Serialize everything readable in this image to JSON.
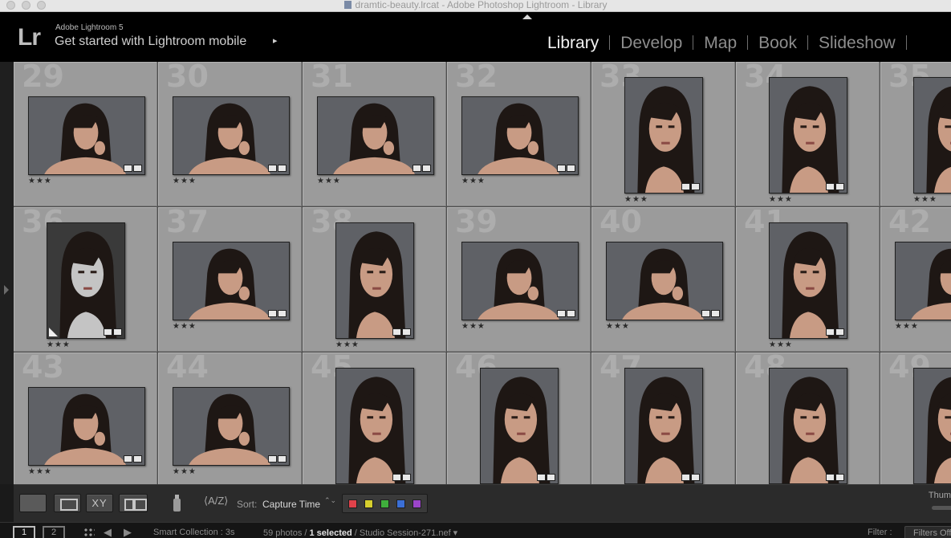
{
  "window": {
    "title": "dramtic-beauty.lrcat - Adobe Photoshop Lightroom - Library"
  },
  "identity": {
    "logo": "Lr",
    "version": "Adobe Lightroom 5",
    "mobile_prompt": "Get started with Lightroom mobile",
    "mobile_arrow": "▸"
  },
  "modules": [
    {
      "label": "Library",
      "active": true
    },
    {
      "label": "Develop",
      "active": false
    },
    {
      "label": "Map",
      "active": false
    },
    {
      "label": "Book",
      "active": false
    },
    {
      "label": "Slideshow",
      "active": false
    }
  ],
  "grid": {
    "stars": "★★★",
    "cells": [
      {
        "index": "29",
        "orientation": "landscape",
        "tone": "color"
      },
      {
        "index": "30",
        "orientation": "landscape",
        "tone": "color"
      },
      {
        "index": "31",
        "orientation": "landscape",
        "tone": "color"
      },
      {
        "index": "32",
        "orientation": "landscape",
        "tone": "color"
      },
      {
        "index": "33",
        "orientation": "portrait",
        "tone": "color"
      },
      {
        "index": "34",
        "orientation": "portrait",
        "tone": "color"
      },
      {
        "index": "35",
        "orientation": "portrait",
        "tone": "color"
      },
      {
        "index": "36",
        "orientation": "portrait",
        "tone": "bw"
      },
      {
        "index": "37",
        "orientation": "landscape",
        "tone": "color"
      },
      {
        "index": "38",
        "orientation": "portrait",
        "tone": "color"
      },
      {
        "index": "39",
        "orientation": "landscape",
        "tone": "color"
      },
      {
        "index": "40",
        "orientation": "landscape",
        "tone": "color"
      },
      {
        "index": "41",
        "orientation": "portrait",
        "tone": "color"
      },
      {
        "index": "42",
        "orientation": "landscape",
        "tone": "color"
      },
      {
        "index": "43",
        "orientation": "landscape",
        "tone": "color"
      },
      {
        "index": "44",
        "orientation": "landscape",
        "tone": "color"
      },
      {
        "index": "45",
        "orientation": "portrait",
        "tone": "color"
      },
      {
        "index": "46",
        "orientation": "portrait",
        "tone": "color"
      },
      {
        "index": "47",
        "orientation": "portrait",
        "tone": "color"
      },
      {
        "index": "48",
        "orientation": "portrait",
        "tone": "color"
      },
      {
        "index": "49",
        "orientation": "portrait",
        "tone": "color"
      }
    ]
  },
  "toolbar": {
    "compare_label": "XY",
    "sort_direction": "⟨A/Z⟩",
    "sort_label": "Sort:",
    "sort_value": "Capture Time",
    "sort_caret": "⌃⌄",
    "color_labels": [
      {
        "name": "red",
        "color": "#e0424a"
      },
      {
        "name": "yellow",
        "color": "#d6cf2e"
      },
      {
        "name": "green",
        "color": "#3fae3c"
      },
      {
        "name": "blue",
        "color": "#3b6fd6"
      },
      {
        "name": "purple",
        "color": "#9b45c9"
      }
    ],
    "thumbnails_label": "Thum"
  },
  "filmstrip": {
    "screen_1": "1",
    "screen_2": "2",
    "source": "Smart Collection : 3s",
    "count": "59 photos /",
    "selected": "1 selected",
    "file": "/ Studio Session-271.nef ▾",
    "filter_label": "Filter :",
    "filter_value": "Filters Off"
  },
  "colors": {
    "background": "#9b9b9b",
    "backdrop": "#5f6166",
    "hair": "#1e1714",
    "skin": "#c89b84"
  }
}
